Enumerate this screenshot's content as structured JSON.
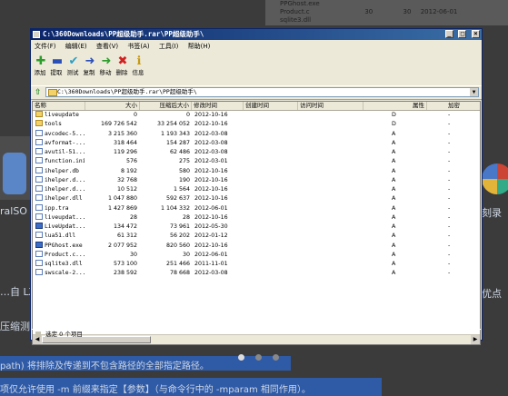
{
  "background": {
    "mini_table": [
      {
        "name": "PPGhost.exe",
        "size": "",
        "packed": "",
        "modified": ""
      },
      {
        "name": "Product.c",
        "size": "30",
        "packed": "30",
        "modified": "2012-06-01"
      },
      {
        "name": "sqlite3.dll",
        "size": "",
        "packed": "",
        "modified": ""
      }
    ],
    "left_texts": [
      "ralSO",
      "…自 LZ",
      "压缩测"
    ],
    "right_texts": [
      "刻录",
      "优点"
    ],
    "bottom_line1": "path) 将排除及传递到不包含路径的全部指定路径。",
    "bottom_line2": "项仅允许使用 -m 前缀来指定【参数】（与命令行中的 -mparam 相同作用）。",
    "carousel": {
      "count": 3,
      "active": 0
    }
  },
  "window": {
    "title": "C:\\360Downloads\\PP超级助手.rar\\PP超级助手\\",
    "buttons": {
      "minimize": "_",
      "maximize": "□",
      "close": "×"
    },
    "menu": [
      "文件(F)",
      "编辑(E)",
      "查看(V)",
      "书签(A)",
      "工具(I)",
      "帮助(H)"
    ],
    "toolbar": [
      {
        "label": "添加",
        "icon": "add-icon",
        "glyph": "✚",
        "color": "#2c9c2c"
      },
      {
        "label": "提取",
        "icon": "extract-icon",
        "glyph": "▬",
        "color": "#2a4fb8"
      },
      {
        "label": "测试",
        "icon": "test-icon",
        "glyph": "✔",
        "color": "#2aa0c8"
      },
      {
        "label": "复制",
        "icon": "copy-icon",
        "glyph": "➜",
        "color": "#2a4fb8"
      },
      {
        "label": "移动",
        "icon": "move-icon",
        "glyph": "➜",
        "color": "#2c9c2c"
      },
      {
        "label": "删除",
        "icon": "delete-icon",
        "glyph": "✖",
        "color": "#d02020"
      },
      {
        "label": "信息",
        "icon": "info-icon",
        "glyph": "ℹ",
        "color": "#c89a10"
      }
    ],
    "address": "C:\\360Downloads\\PP超级助手.rar\\PP超级助手\\",
    "columns": {
      "name": "名称",
      "size": "大小",
      "packed": "压缩后大小",
      "modified": "修改时间",
      "created": "创建时间",
      "accessed": "访问时间",
      "attributes": "属性",
      "encrypted": "加密"
    },
    "files": [
      {
        "name": "liveupdate",
        "type": "folder",
        "size": "0",
        "packed": "0",
        "modified": "2012-10-16",
        "attr": "D",
        "enc": "-"
      },
      {
        "name": "tools",
        "type": "folder",
        "size": "169 726 542",
        "packed": "33 254 052",
        "modified": "2012-10-16",
        "attr": "D",
        "enc": "-"
      },
      {
        "name": "avcodec-5...",
        "type": "file",
        "size": "3 215 360",
        "packed": "1 193 343",
        "modified": "2012-03-08",
        "attr": "A",
        "enc": "-"
      },
      {
        "name": "avformat-...",
        "type": "file",
        "size": "318 464",
        "packed": "154 287",
        "modified": "2012-03-08",
        "attr": "A",
        "enc": "-"
      },
      {
        "name": "avutil-51...",
        "type": "file",
        "size": "119 296",
        "packed": "62 486",
        "modified": "2012-03-08",
        "attr": "A",
        "enc": "-"
      },
      {
        "name": "function.ini",
        "type": "file",
        "size": "576",
        "packed": "275",
        "modified": "2012-03-01",
        "attr": "A",
        "enc": "-"
      },
      {
        "name": "ihelper.db",
        "type": "file",
        "size": "8 192",
        "packed": "580",
        "modified": "2012-10-16",
        "attr": "A",
        "enc": "-"
      },
      {
        "name": "ihelper.d...",
        "type": "file",
        "size": "32 768",
        "packed": "190",
        "modified": "2012-10-16",
        "attr": "A",
        "enc": "-"
      },
      {
        "name": "ihelper.d...",
        "type": "file",
        "size": "10 512",
        "packed": "1 564",
        "modified": "2012-10-16",
        "attr": "A",
        "enc": "-"
      },
      {
        "name": "ihelper.dll",
        "type": "file",
        "size": "1 047 880",
        "packed": "592 637",
        "modified": "2012-10-16",
        "attr": "A",
        "enc": "-"
      },
      {
        "name": "ipp.tra",
        "type": "file",
        "size": "1 427 869",
        "packed": "1 104 332",
        "modified": "2012-06-01",
        "attr": "A",
        "enc": "-"
      },
      {
        "name": "liveupdat...",
        "type": "file",
        "size": "28",
        "packed": "28",
        "modified": "2012-10-16",
        "attr": "A",
        "enc": "-"
      },
      {
        "name": "LiveUpdat...",
        "type": "app",
        "size": "134 472",
        "packed": "73 961",
        "modified": "2012-05-30",
        "attr": "A",
        "enc": "-"
      },
      {
        "name": "lua51.dll",
        "type": "file",
        "size": "61 312",
        "packed": "56 202",
        "modified": "2012-01-12",
        "attr": "A",
        "enc": "-"
      },
      {
        "name": "PPGhost.exe",
        "type": "app",
        "size": "2 077 952",
        "packed": "820 560",
        "modified": "2012-10-16",
        "attr": "A",
        "enc": "-"
      },
      {
        "name": "Product.c...",
        "type": "file",
        "size": "30",
        "packed": "30",
        "modified": "2012-06-01",
        "attr": "A",
        "enc": "-"
      },
      {
        "name": "sqlite3.dll",
        "type": "file",
        "size": "573 100",
        "packed": "251 466",
        "modified": "2011-11-01",
        "attr": "A",
        "enc": "-"
      },
      {
        "name": "swscale-2...",
        "type": "file",
        "size": "238 592",
        "packed": "78 668",
        "modified": "2012-03-08",
        "attr": "A",
        "enc": "-"
      }
    ],
    "status": "选定 0 个项目",
    "colors": {
      "title_start": "#0a246a",
      "title_end": "#3a6ea5",
      "face": "#ece9d8"
    }
  }
}
